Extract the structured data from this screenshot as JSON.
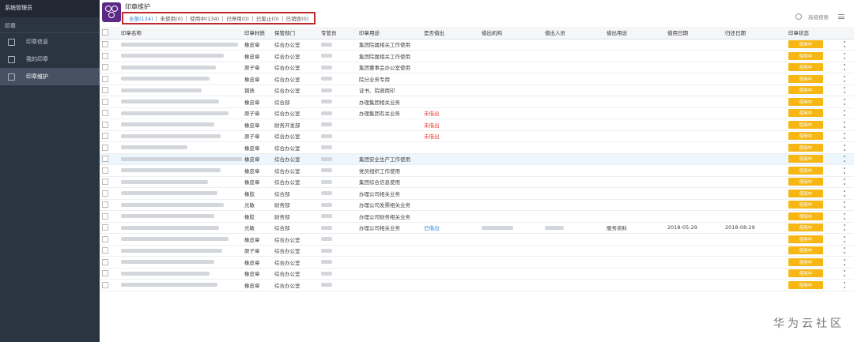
{
  "sidebar": {
    "title": "系统管理员",
    "section": "印章",
    "items": [
      {
        "label": "印章信息",
        "icon": "document-icon",
        "active": false
      },
      {
        "label": "我的印章",
        "icon": "stamp-icon",
        "active": false
      },
      {
        "label": "印章维护",
        "icon": "edit-icon",
        "active": true
      }
    ]
  },
  "header": {
    "title": "印章维护",
    "search_label": "高级搜索"
  },
  "tabs": [
    "全部(134)",
    "未使用(0)",
    "使用中(134)",
    "已停用(0)",
    "已废止(0)",
    "已销毁(0)"
  ],
  "columns": [
    "",
    "印章名称",
    "印章材质",
    "保管部门",
    "专管员",
    "印章用途",
    "是否借出",
    "借出机构",
    "借出人员",
    "借出用途",
    "借用日期",
    "归还日期",
    "印章状态",
    ""
  ],
  "rows": [
    {
      "material": "橡皮章",
      "dept": "综合办公室",
      "use": "集团院属相关工作使用",
      "lent": "",
      "status": "使用中"
    },
    {
      "material": "橡皮章",
      "dept": "综合办公室",
      "use": "集团院属相关工作使用",
      "lent": "",
      "status": "使用中"
    },
    {
      "material": "原子章",
      "dept": "综合办公室",
      "use": "集团董事会办公室使用",
      "lent": "",
      "status": "使用中"
    },
    {
      "material": "橡皮章",
      "dept": "综合办公室",
      "use": "院分业务专用",
      "lent": "",
      "status": "使用中"
    },
    {
      "material": "钢质",
      "dept": "综合办公室",
      "use": "证书、院颁用印",
      "lent": "",
      "status": "使用中"
    },
    {
      "material": "橡皮章",
      "dept": "综合部",
      "use": "办理集团相关业务",
      "lent": "",
      "status": "使用中"
    },
    {
      "material": "原子章",
      "dept": "综合办公室",
      "use": "办理集团有关业务",
      "lent": "未借出",
      "status": "使用中"
    },
    {
      "material": "橡皮章",
      "dept": "财务开发部",
      "use": "",
      "lent": "未借出",
      "status": "使用中"
    },
    {
      "material": "原子章",
      "dept": "综合办公室",
      "use": "",
      "lent": "未借出",
      "status": "使用中"
    },
    {
      "material": "橡皮章",
      "dept": "综合办公室",
      "use": "",
      "lent": "",
      "status": "使用中"
    },
    {
      "material": "橡皮章",
      "dept": "综合办公室",
      "use": "集团安全生产工作使用",
      "lent": "",
      "status": "使用中"
    },
    {
      "material": "橡皮章",
      "dept": "综合办公室",
      "use": "党员组织工作使用",
      "lent": "",
      "status": "使用中"
    },
    {
      "material": "橡皮章",
      "dept": "综合办公室",
      "use": "集团综合信息使用",
      "lent": "",
      "status": "使用中"
    },
    {
      "material": "橡胶",
      "dept": "综合部",
      "use": "办理公司相关业务",
      "lent": "",
      "status": "使用中"
    },
    {
      "material": "光敏",
      "dept": "财务部",
      "use": "办理公司发票相关业务",
      "lent": "",
      "status": "使用中"
    },
    {
      "material": "橡胶",
      "dept": "财务部",
      "use": "办理公司财务相关业务",
      "lent": "",
      "status": "使用中"
    },
    {
      "material": "光敏",
      "dept": "综合部",
      "use": "办理公司相关业务",
      "lent": "已借出",
      "lend_user": "",
      "lend_use": "服务资料",
      "borrow_date": "2018-05-29",
      "return_date": "2018-08-29",
      "status": "使用中"
    },
    {
      "material": "橡皮章",
      "dept": "综合办公室",
      "use": "",
      "lent": "",
      "status": "使用中"
    },
    {
      "material": "原子章",
      "dept": "综合办公室",
      "use": "",
      "lent": "",
      "status": "使用中"
    },
    {
      "material": "橡皮章",
      "dept": "综合办公室",
      "use": "",
      "lent": "",
      "status": "使用中"
    },
    {
      "material": "橡皮章",
      "dept": "综合办公室",
      "use": "",
      "lent": "",
      "status": "使用中"
    },
    {
      "material": "橡皮章",
      "dept": "综合办公室",
      "use": "",
      "lent": "",
      "status": "使用中"
    }
  ],
  "watermark": "华为云社区",
  "colors": {
    "sidebar": "#2b3441",
    "accent": "#2f83d6",
    "badge": "#f6b714",
    "tab_border": "#c0292a"
  }
}
